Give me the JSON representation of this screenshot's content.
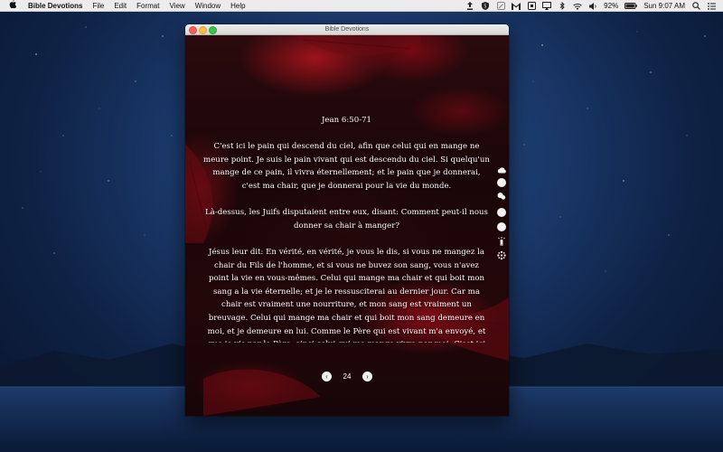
{
  "menubar": {
    "app_name": "Bible Devotions",
    "menus": [
      "File",
      "Edit",
      "Format",
      "View",
      "Window",
      "Help"
    ],
    "battery": "92%",
    "clock": "Sun 9:07 AM"
  },
  "window": {
    "title": "Bible Devotions"
  },
  "devotion": {
    "reference": "Jean 6:50-71",
    "paragraphs": [
      "C'est ici le pain qui descend du ciel, afin que celui qui en mange ne meure point. Je suis le pain vivant qui est descendu du ciel. Si quelqu'un mange de ce pain, il vivra éternellement; et le pain que je donnerai, c'est ma chair, que je donnerai pour la vie du monde.",
      "Là-dessus, les Juifs disputaient entre eux, disant: Comment peut-il nous donner sa chair à manger?",
      "Jésus leur dit: En vérité, en vérité, je vous le dis, si vous ne mangez la chair du Fils de l'homme, et si vous ne buvez son sang, vous n'avez point la vie en vous-mêmes. Celui qui mange ma chair et qui boit mon sang a la vie éternelle; et je le ressusciterai au dernier jour. Car ma chair est vraiment une nourriture, et mon sang est vraiment un breuvage. Celui qui mange ma chair et qui boit mon sang demeure en moi, et je demeure en lui. Comme le Père qui est vivant m'a envoyé, et que je vis par le Père, ainsi celui qui me mange vivra par moi. C'est ici le pain qui est descendu du ciel. Il n'en est pas comme de"
    ]
  },
  "pager": {
    "page": "24"
  },
  "icons": {
    "prev": "prev-arrow-icon",
    "next": "next-arrow-icon"
  }
}
